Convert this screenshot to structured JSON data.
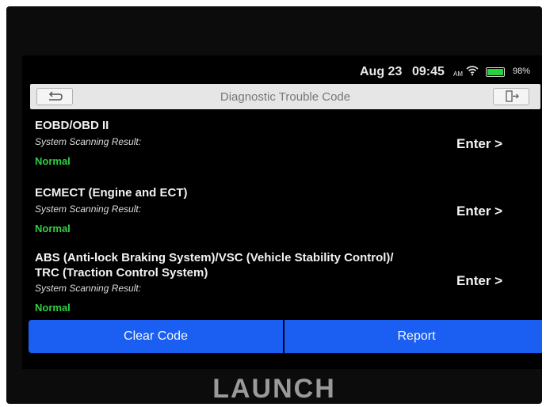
{
  "status_bar": {
    "date": "Aug 23",
    "time": "09:45",
    "ampm": "AM",
    "wifi_icon": "wifi-icon",
    "battery_icon": "battery-icon",
    "battery_percent": "98%",
    "battery_color": "#29d23a"
  },
  "header": {
    "title": "Diagnostic Trouble Code",
    "back_icon": "back-arrow-icon",
    "exit_icon": "exit-icon"
  },
  "systems": [
    {
      "name_line1": "EOBD/OBD II",
      "name_line2": "",
      "scan_label": "System Scanning Result:",
      "status": "Normal",
      "enter_label": "Enter >"
    },
    {
      "name_line1": "ECMECT (Engine and ECT)",
      "name_line2": "",
      "scan_label": "System Scanning Result:",
      "status": "Normal",
      "enter_label": "Enter >"
    },
    {
      "name_line1": "ABS (Anti-lock Braking System)/VSC (Vehicle Stability Control)/",
      "name_line2": "TRC (Traction Control System)",
      "scan_label": "System Scanning Result:",
      "status": "Normal",
      "enter_label": "Enter >"
    }
  ],
  "actions": {
    "clear_code_label": "Clear Code",
    "report_label": "Report",
    "button_color": "#1a5ff2",
    "status_color": "#2fcf42"
  },
  "device": {
    "brand": "LAUNCH"
  }
}
